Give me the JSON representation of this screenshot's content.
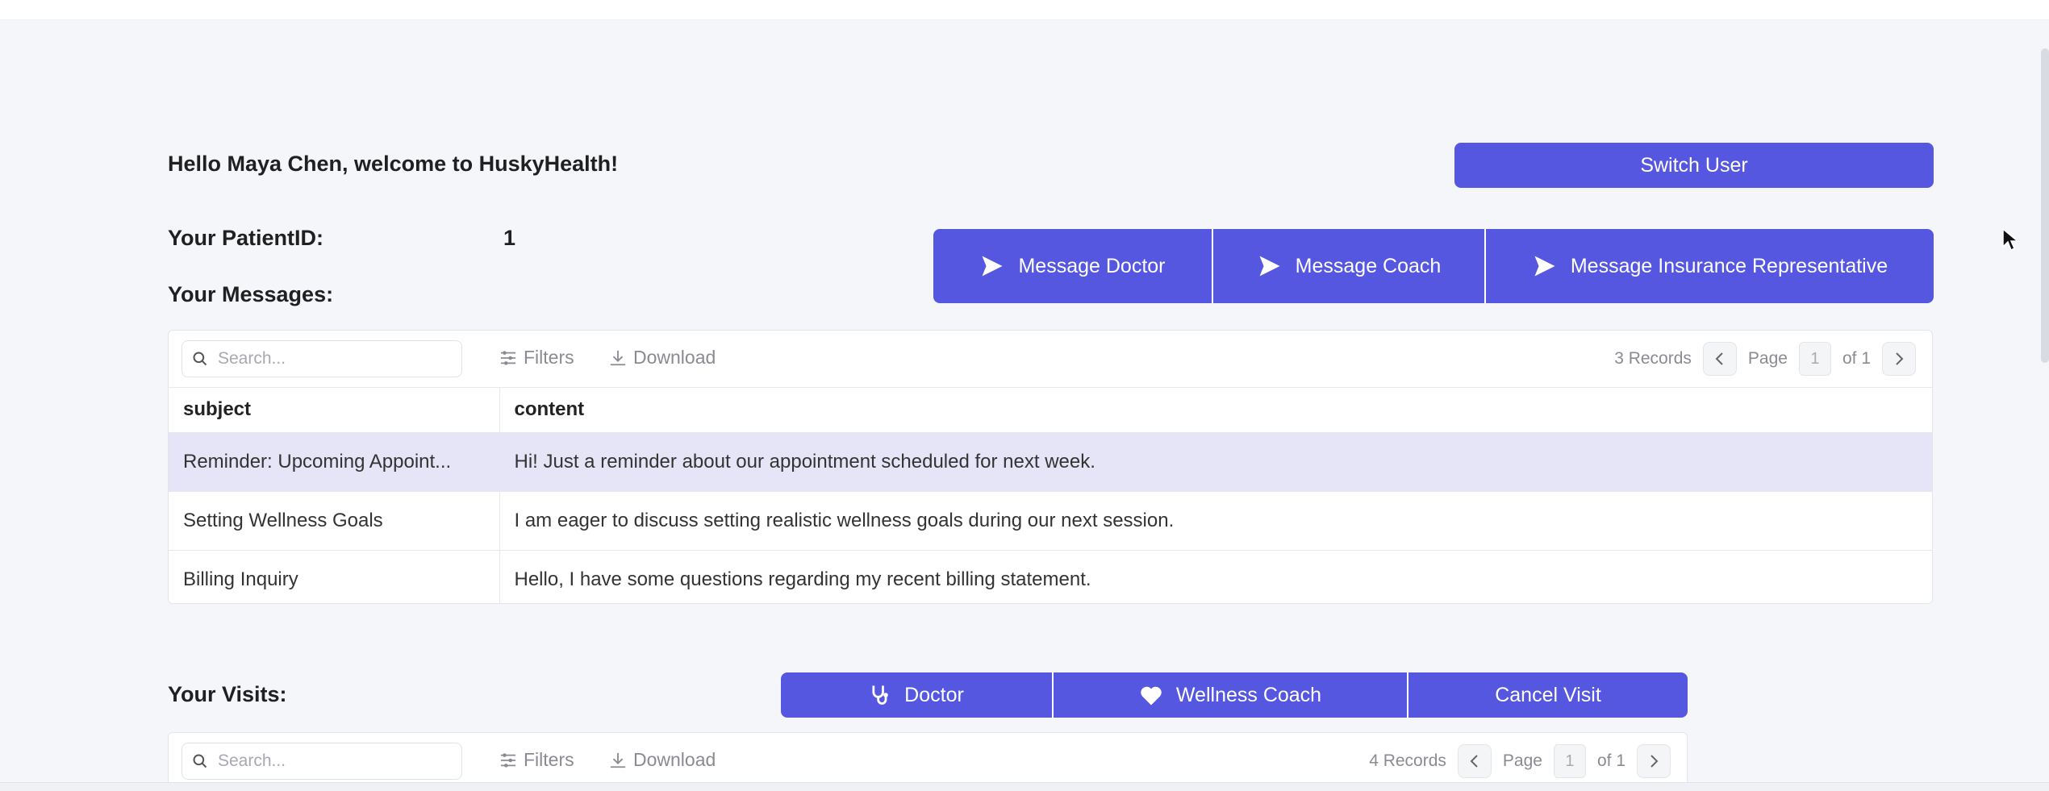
{
  "header": {
    "welcome": "Hello Maya Chen, welcome to HuskyHealth!",
    "switch_user": "Switch User"
  },
  "patient": {
    "id_label": "Your PatientID:",
    "id_value": "1"
  },
  "messages": {
    "section_label": "Your Messages:",
    "buttons": {
      "doctor": "Message Doctor",
      "coach": "Message Coach",
      "insurance": "Message Insurance Representative"
    },
    "toolbar": {
      "search_placeholder": "Search...",
      "filters": "Filters",
      "download": "Download",
      "records": "3 Records",
      "page_label": "Page",
      "page_value": "1",
      "of_label": "of 1"
    },
    "columns": [
      "subject",
      "content"
    ],
    "rows": [
      {
        "subject": "Reminder: Upcoming Appoint...",
        "content": "Hi! Just a reminder about our appointment scheduled for next week."
      },
      {
        "subject": "Setting Wellness Goals",
        "content": "I am eager to discuss setting realistic wellness goals during our next session."
      },
      {
        "subject": "Billing Inquiry",
        "content": "Hello, I have some questions regarding my recent billing statement."
      }
    ]
  },
  "visits": {
    "section_label": "Your Visits:",
    "buttons": {
      "doctor": "Doctor",
      "coach": "Wellness Coach",
      "cancel": "Cancel Visit"
    },
    "toolbar": {
      "search_placeholder": "Search...",
      "filters": "Filters",
      "download": "Download",
      "records": "4 Records",
      "page_label": "Page",
      "page_value": "1",
      "of_label": "of 1"
    }
  },
  "theme": {
    "accent": "#5557e0",
    "selected_row": "#e5e5f7",
    "background": "#f5f6fa"
  },
  "icons": {
    "send": "send-icon",
    "stethoscope": "stethoscope-icon",
    "heart": "heart-icon",
    "search": "search-icon",
    "filter": "filter-icon",
    "download": "download-icon"
  }
}
